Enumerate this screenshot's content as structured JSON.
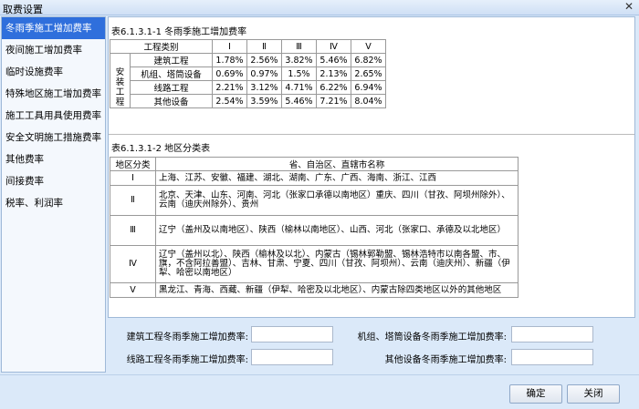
{
  "window": {
    "title": "取费设置"
  },
  "sidebar": {
    "items": [
      {
        "label": "冬雨季施工增加费率",
        "active": true
      },
      {
        "label": "夜间施工增加费率"
      },
      {
        "label": "临时设施费率"
      },
      {
        "label": "特殊地区施工增加费率"
      },
      {
        "label": "施工工具用具使用费率"
      },
      {
        "label": "安全文明施工措施费率"
      },
      {
        "label": "其他费率"
      },
      {
        "label": "间接费率"
      },
      {
        "label": "税率、利润率"
      }
    ]
  },
  "rate_table": {
    "caption": "表6.1.3.1-1  冬雨季施工增加费率",
    "header": [
      "工程类别",
      "Ⅰ",
      "Ⅱ",
      "Ⅲ",
      "Ⅳ",
      "Ⅴ"
    ],
    "row0": {
      "label": "建筑工程",
      "values": [
        "1.78%",
        "2.56%",
        "3.82%",
        "5.46%",
        "6.82%"
      ]
    },
    "group_label": "安装工程",
    "rows": [
      {
        "label": "机组、塔筒设备",
        "values": [
          "0.69%",
          "0.97%",
          "1.5%",
          "2.13%",
          "2.65%"
        ]
      },
      {
        "label": "线路工程",
        "values": [
          "2.21%",
          "3.12%",
          "4.71%",
          "6.22%",
          "6.94%"
        ]
      },
      {
        "label": "其他设备",
        "values": [
          "2.54%",
          "3.59%",
          "5.46%",
          "7.21%",
          "8.04%"
        ]
      }
    ]
  },
  "region_table": {
    "caption": "表6.1.3.1-2  地区分类表",
    "header": [
      "地区分类",
      "省、自治区、直辖市名称"
    ],
    "rows": [
      {
        "cls": "Ⅰ",
        "desc": "上海、江苏、安徽、福建、湖北、湖南、广东、广西、海南、浙江、江西"
      },
      {
        "cls": "Ⅱ",
        "desc": "北京、天津、山东、河南、河北（张家口承德以南地区）重庆、四川（甘孜、阿坝州除外）、云南（迪庆州除外）、贵州"
      },
      {
        "cls": "Ⅲ",
        "desc": "辽宁（盖州及以南地区）、陕西（榆林以南地区）、山西、河北（张家口、承德及以北地区）"
      },
      {
        "cls": "Ⅳ",
        "desc": "辽宁（盖州以北）、陕西（榆林及以北）、内蒙古（锡林郭勒盟、锡林浩特市以南各盟、市、旗，不含阿拉善盟）、吉林、甘肃、宁夏、四川（甘孜、阿坝州）、云南（迪庆州）、新疆（伊犁、哈密以南地区）"
      },
      {
        "cls": "Ⅴ",
        "desc": "黑龙江、青海、西藏、新疆（伊犁、哈密及以北地区）、内蒙古除四类地区以外的其他地区"
      }
    ]
  },
  "form": {
    "building_label": "建筑工程冬雨季施工增加费率:",
    "building_value": "",
    "unit_label": "机组、塔筒设备冬雨季施工增加费率:",
    "unit_value": "",
    "line_label": "线路工程冬雨季施工增加费率:",
    "line_value": "",
    "other_label": "其他设备冬雨季施工增加费率:",
    "other_value": ""
  },
  "buttons": {
    "ok": "确定",
    "close": "关闭"
  },
  "icons": {
    "close": "close-icon"
  }
}
